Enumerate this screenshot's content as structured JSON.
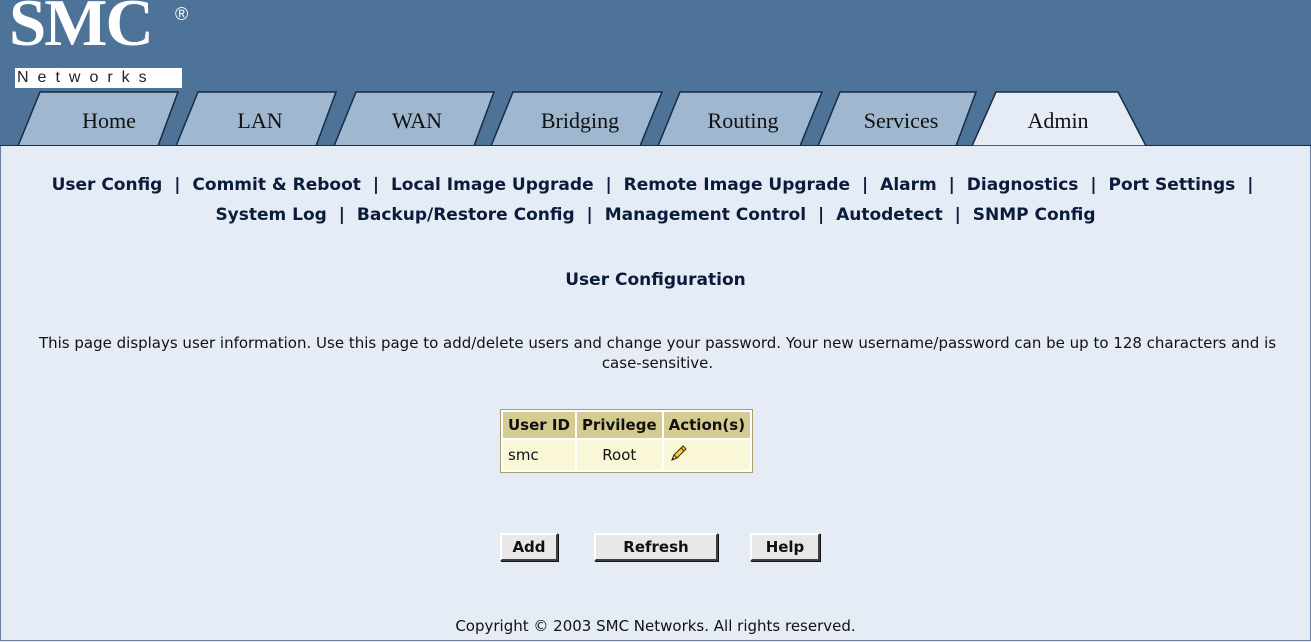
{
  "brand": {
    "logo": "SMC",
    "registered": "®",
    "subtitle": "Networks"
  },
  "tabs": [
    {
      "label": "Home",
      "active": false
    },
    {
      "label": "LAN",
      "active": false
    },
    {
      "label": "WAN",
      "active": false
    },
    {
      "label": "Bridging",
      "active": false
    },
    {
      "label": "Routing",
      "active": false
    },
    {
      "label": "Services",
      "active": false
    },
    {
      "label": "Admin",
      "active": true
    }
  ],
  "subnav": {
    "row1": [
      "User Config",
      "Commit & Reboot",
      "Local Image Upgrade",
      "Remote Image Upgrade",
      "Alarm",
      "Diagnostics",
      "Port Settings"
    ],
    "row2": [
      "System Log",
      "Backup/Restore Config",
      "Management Control",
      "Autodetect",
      "SNMP Config"
    ],
    "separator": "|"
  },
  "page": {
    "title": "User Configuration",
    "description": "This page displays user information. Use this page to add/delete users and change your password. Your new username/password can be up to 128 characters and is case-sensitive."
  },
  "table": {
    "headers": [
      "User ID",
      "Privilege",
      "Action(s)"
    ],
    "rows": [
      {
        "user_id": "smc",
        "privilege": "Root",
        "action_icon": "pencil-edit-icon"
      }
    ]
  },
  "buttons": {
    "add": "Add",
    "refresh": "Refresh",
    "help": "Help"
  },
  "footer": "Copyright © 2003 SMC Networks. All rights reserved.",
  "colors": {
    "header_bg": "#4d7399",
    "tab_inactive": "#9fb7cf",
    "tab_active": "#e6ecf6",
    "page_bg": "#e6ecf6",
    "table_header": "#d5cc92",
    "table_cell": "#faf7d6"
  }
}
